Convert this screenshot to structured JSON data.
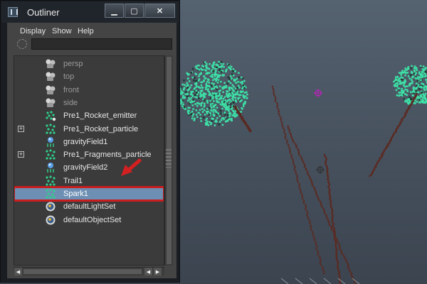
{
  "window": {
    "title": "Outliner",
    "minimize": "▁",
    "maximize": "▢",
    "close": "✕"
  },
  "menu": [
    "Display",
    "Show",
    "Help"
  ],
  "filter": {
    "value": ""
  },
  "outliner_items": [
    {
      "label": "persp",
      "icon": "camera-icon",
      "dim": true,
      "expander": false
    },
    {
      "label": "top",
      "icon": "camera-icon",
      "dim": true,
      "expander": false
    },
    {
      "label": "front",
      "icon": "camera-icon",
      "dim": true,
      "expander": false
    },
    {
      "label": "side",
      "icon": "camera-icon",
      "dim": true,
      "expander": false
    },
    {
      "label": "Pre1_Rocket_emitter",
      "icon": "emitter-icon",
      "dim": false,
      "expander": false
    },
    {
      "label": "Pre1_Rocket_particle",
      "icon": "particle-icon",
      "dim": false,
      "expander": true
    },
    {
      "label": "gravityField1",
      "icon": "gravity-field-icon",
      "dim": false,
      "expander": false
    },
    {
      "label": "Pre1_Fragments_particle",
      "icon": "particle-icon",
      "dim": false,
      "expander": true
    },
    {
      "label": "gravityField2",
      "icon": "gravity-field-icon",
      "dim": false,
      "expander": false
    },
    {
      "label": "Trail1",
      "icon": "particle-icon",
      "dim": false,
      "expander": false
    },
    {
      "label": "Spark1",
      "icon": "particle-icon",
      "dim": false,
      "expander": false,
      "selected": true
    },
    {
      "label": "defaultLightSet",
      "icon": "set-icon",
      "dim": false,
      "expander": false
    },
    {
      "label": "defaultObjectSet",
      "icon": "set-icon",
      "dim": false,
      "expander": false
    }
  ],
  "colors": {
    "selection": "#6e8fb4",
    "highlight_box": "#c81e1e",
    "particle_green": "#3de0a6",
    "trail_brown": "#5a2a22"
  }
}
